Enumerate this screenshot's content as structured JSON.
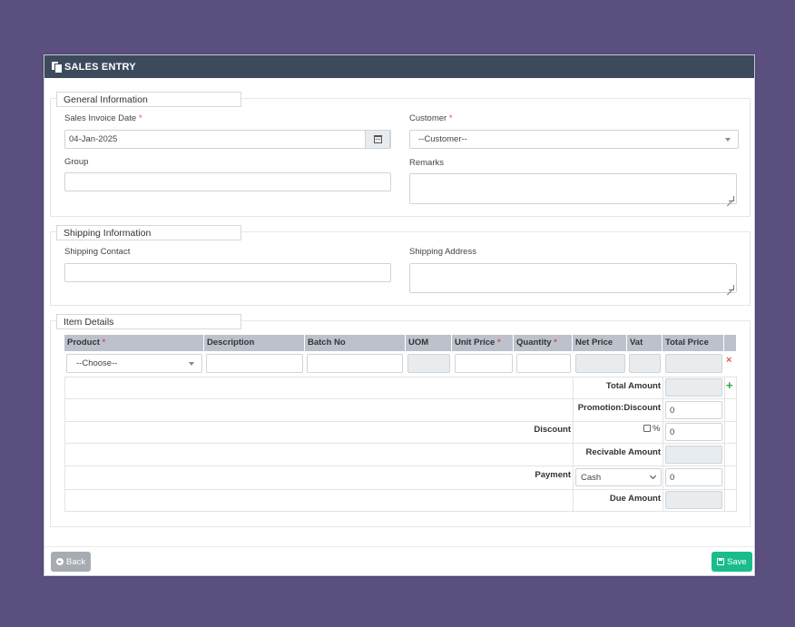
{
  "header": {
    "title": "SALES ENTRY",
    "icon": "copy-icon"
  },
  "general": {
    "legend": "General Information",
    "invoice_date_label": "Sales Invoice Date",
    "invoice_date_value": "04-Jan-2025",
    "customer_label": "Customer",
    "customer_value": "--Customer--",
    "group_label": "Group",
    "remarks_label": "Remarks",
    "required_mark": "*"
  },
  "shipping": {
    "legend": "Shipping Information",
    "contact_label": "Shipping Contact",
    "address_label": "Shipping Address"
  },
  "items": {
    "legend": "Item Details",
    "columns": {
      "product": "Product",
      "description": "Description",
      "batch": "Batch No",
      "uom": "UOM",
      "unit_price": "Unit Price",
      "quantity": "Quantity",
      "net_price": "Net Price",
      "vat": "Vat",
      "total_price": "Total Price"
    },
    "product_placeholder": "--Choose--",
    "delete_icon": "×",
    "add_icon": "+",
    "summary": {
      "total_amount": "Total Amount",
      "promotion_discount": "Promotion:Discount",
      "promotion_value": "0",
      "discount": "Discount",
      "percent": "%",
      "discount_value": "0",
      "receivable": "Recivable Amount",
      "payment": "Payment",
      "payment_method": "Cash",
      "payment_value": "0",
      "due_amount": "Due Amount"
    }
  },
  "footer": {
    "back_label": "Back",
    "save_label": "Save"
  },
  "colors": {
    "header_bg": "#3d4a5c",
    "page_bg": "#5a4f7f",
    "table_header": "#bcc1cb",
    "save": "#1abc8c",
    "back": "#a6acb2"
  }
}
